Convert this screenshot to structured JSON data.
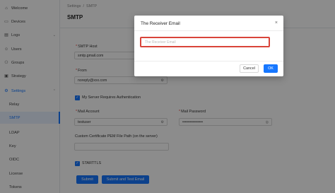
{
  "sidebar": {
    "items": [
      {
        "label": "Welcome",
        "icon": "home-icon"
      },
      {
        "label": "Devices",
        "icon": "monitor-icon"
      },
      {
        "label": "Logs",
        "icon": "document-icon"
      },
      {
        "label": "Users",
        "icon": "user-icon"
      },
      {
        "label": "Groups",
        "icon": "group-icon"
      },
      {
        "label": "Strategy",
        "icon": "strategy-icon"
      },
      {
        "label": "Settings",
        "icon": "gear-icon"
      }
    ],
    "sub_items": [
      "Relay",
      "SMTP",
      "LDAP",
      "Key",
      "OIDC",
      "License",
      "Tokens"
    ],
    "active": "SMTP"
  },
  "breadcrumb": {
    "parent": "Settings",
    "separator": "/",
    "current": "SMTP"
  },
  "page_title": "SMTP",
  "form": {
    "smtp_host": {
      "label": "SMTP Host",
      "value": "smtp.gmail.com"
    },
    "from": {
      "label": "From",
      "value": "noreply@xxx.com"
    },
    "auth_required": {
      "label": "My Server Requires Authentication",
      "checked": true
    },
    "mail_account": {
      "label": "Mail Account",
      "value": "testuser"
    },
    "mail_password": {
      "label": "Mail Password",
      "value": "••••••••••••••••"
    },
    "cert_path": {
      "label": "Custom Certificate PEM File Path (on the server)",
      "value": ""
    },
    "starttls": {
      "label": "STARTTLS",
      "checked": true
    },
    "submit_label": "Submit",
    "submit_test_label": "Submit and Test Email"
  },
  "modal": {
    "title": "The Receiver Email",
    "close": "×",
    "input_placeholder": "The Receiver Email",
    "cancel_label": "Cancel",
    "ok_label": "OK"
  },
  "colors": {
    "accent": "#1677ff",
    "error_border": "#d9443a",
    "required": "#e53935"
  }
}
